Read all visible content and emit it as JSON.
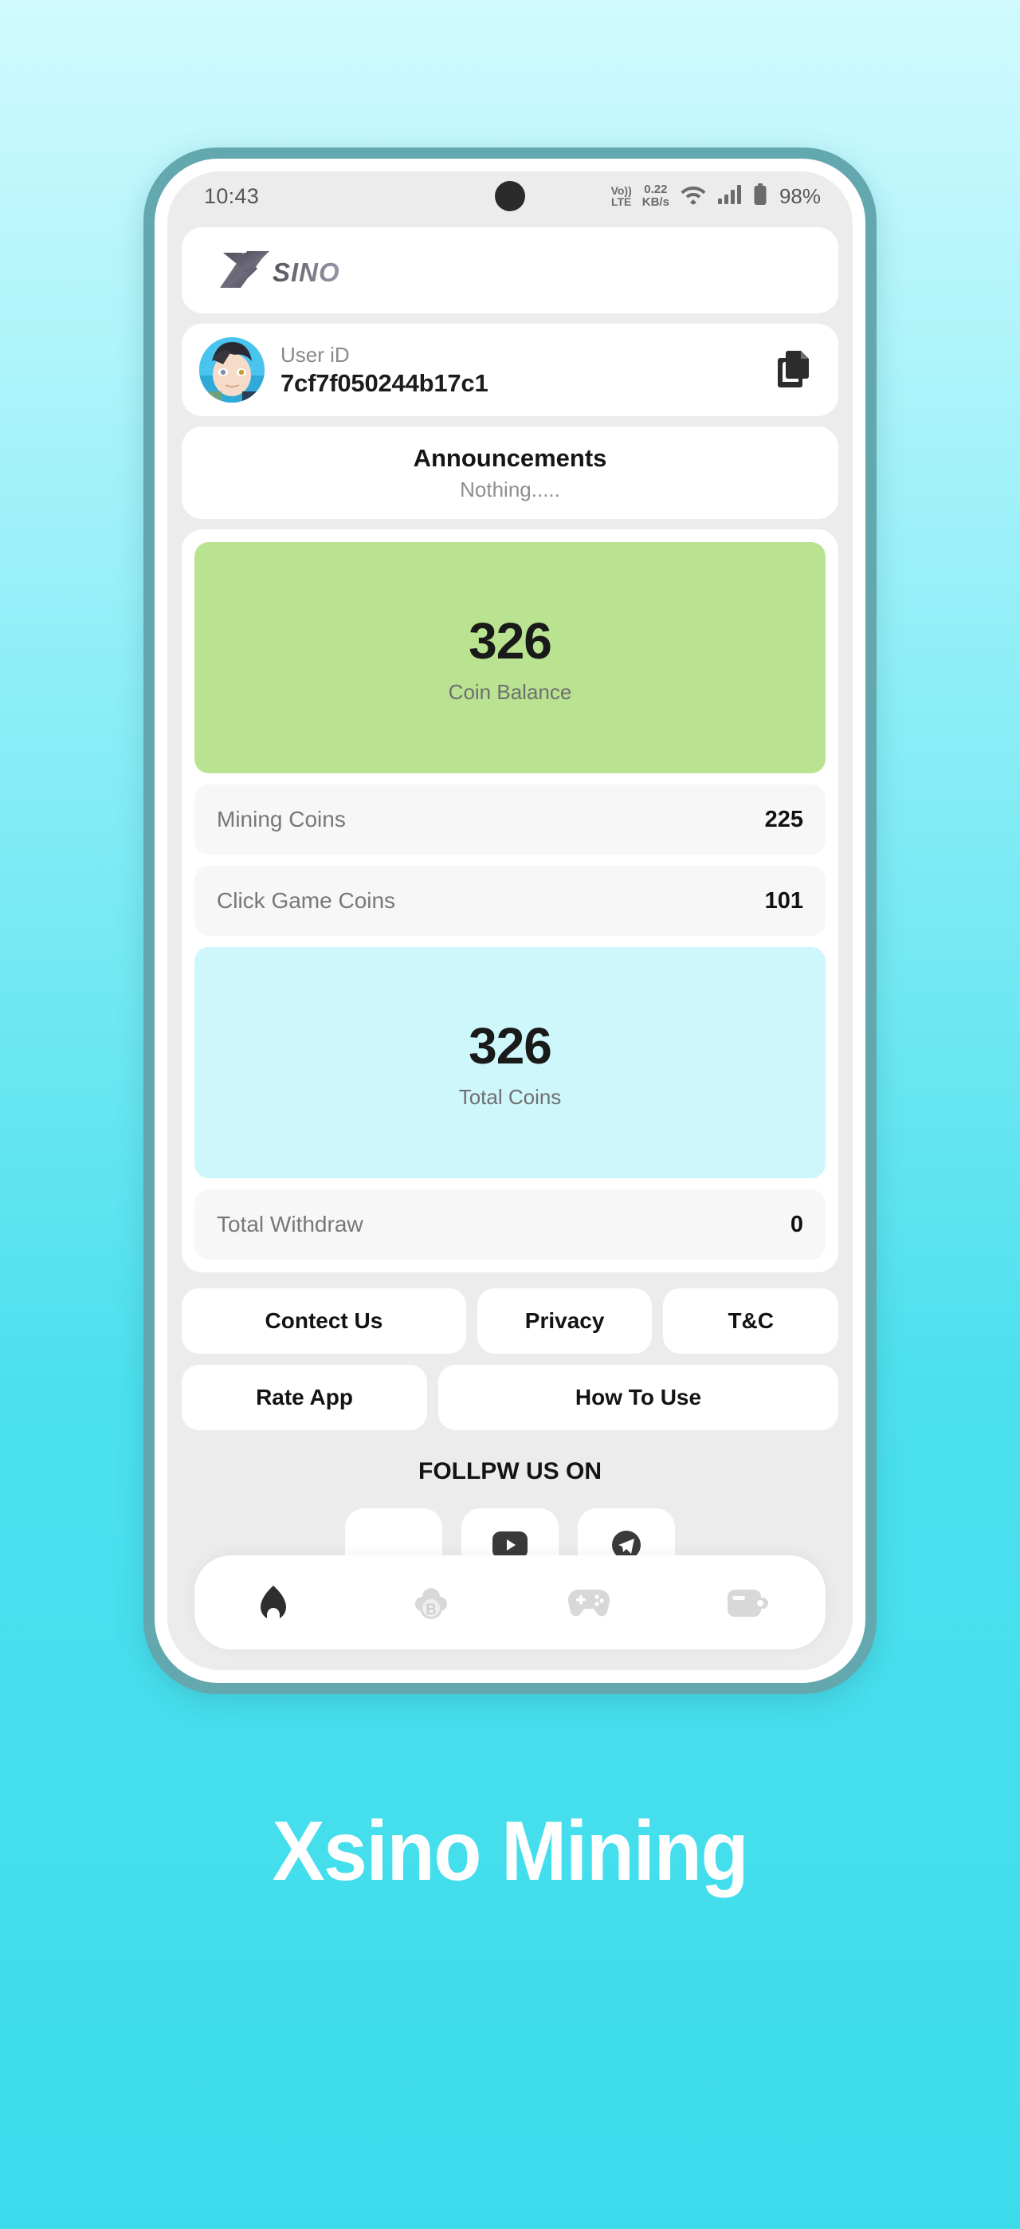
{
  "statusbar": {
    "time": "10:43",
    "volte_top": "Vo))",
    "volte_bottom": "LTE",
    "netspeed_value": "0.22",
    "netspeed_unit": "KB/s",
    "wifi_icon": "wifi-icon",
    "signal_icon": "cellular-signal-icon",
    "battery_icon": "battery-icon",
    "battery_percent": "98%"
  },
  "header": {
    "logo_x": "X",
    "logo_text": "SINO",
    "logo_alt": "xsino-logo"
  },
  "user": {
    "label": "User iD",
    "value": "7cf7f050244b17c1",
    "copy_icon": "copy-icon",
    "avatar_icon": "user-avatar"
  },
  "announcements": {
    "title": "Announcements",
    "body": "Nothing....."
  },
  "balance": {
    "coin_balance_value": "326",
    "coin_balance_label": "Coin Balance",
    "coin_balance_color": "#b9e391",
    "total_coins_value": "326",
    "total_coins_label": "Total Coins",
    "total_coins_color": "#cdf7fb",
    "rows": [
      {
        "label": "Mining Coins",
        "value": "225"
      },
      {
        "label": "Click Game Coins",
        "value": "101"
      },
      {
        "label": "Total Withdraw",
        "value": "0"
      }
    ]
  },
  "links": {
    "contact": "Contect Us",
    "privacy": "Privacy",
    "tc": "T&C",
    "rate": "Rate App",
    "how": "How To Use"
  },
  "follow": {
    "title": "FOLLPW US ON",
    "items": [
      {
        "icon": "social-icon-1"
      },
      {
        "icon": "social-icon-2"
      },
      {
        "icon": "social-icon-3"
      }
    ]
  },
  "nav": [
    {
      "icon": "home-icon",
      "active": true
    },
    {
      "icon": "cloud-mining-bitcoin-icon",
      "active": false
    },
    {
      "icon": "game-controller-icon",
      "active": false
    },
    {
      "icon": "wallet-icon",
      "active": false
    }
  ],
  "promo": {
    "headline": "Xsino Mining"
  },
  "theme": {
    "frame_color": "#63a8ae",
    "background_top": "#d0faff",
    "background_bottom": "#3ddcec",
    "screen_bg": "#ececec"
  }
}
